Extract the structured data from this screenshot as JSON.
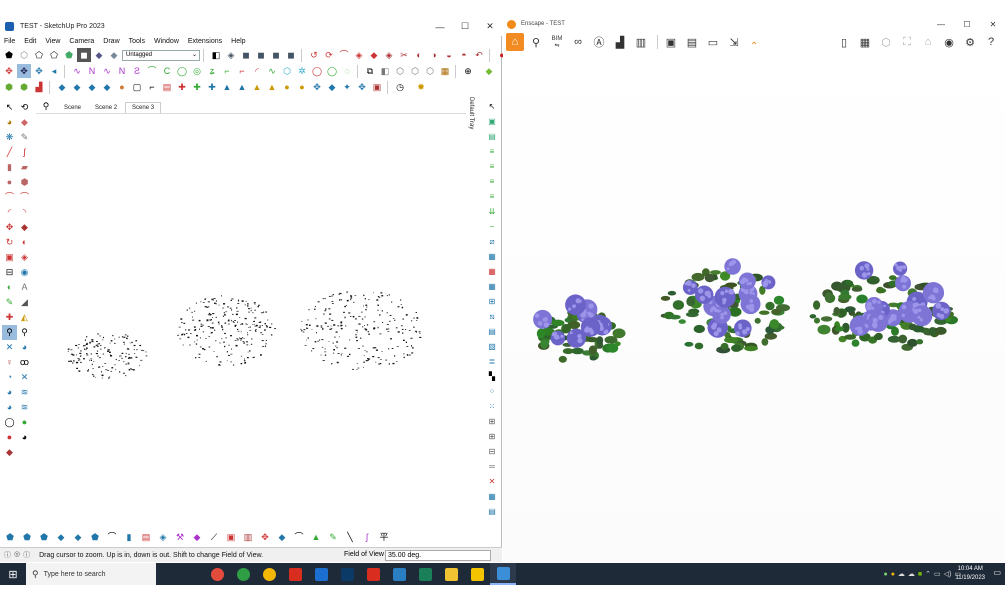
{
  "sketchup": {
    "title": "TEST - SketchUp Pro 2023",
    "menu": [
      "File",
      "Edit",
      "View",
      "Camera",
      "Draw",
      "Tools",
      "Window",
      "Extensions",
      "Help"
    ],
    "tag_select": "Untagged",
    "scenes": [
      "Scene",
      "Scene 2",
      "Scene 3"
    ],
    "active_scene": "Scene 3",
    "tray_label": "Default Tray",
    "status_message": "Drag cursor to zoom.  Up is in, down is out. Shift to change Field of View.",
    "fov_label": "Field of View",
    "fov_value": "35.00 deg."
  },
  "enscape": {
    "title": "Enscape - TEST",
    "toolbar_icons": [
      "home-icon",
      "pin-icon",
      "bim-icon",
      "binoculars-icon",
      "a-icon",
      "buildings-icon",
      "building-icon",
      "screenshot-icon",
      "batch-render-icon",
      "video-icon",
      "export-icon",
      "library-icon",
      "material-icon",
      "asset-icon",
      "sun-icon",
      "hat-icon",
      "visual-settings-icon",
      "settings-icon",
      "help-icon"
    ],
    "bim_label": "BIM",
    "accent": "#f28c22"
  },
  "taskbar": {
    "search_placeholder": "Type here to search",
    "time": "10:04 AM",
    "date": "11/19/2023"
  }
}
